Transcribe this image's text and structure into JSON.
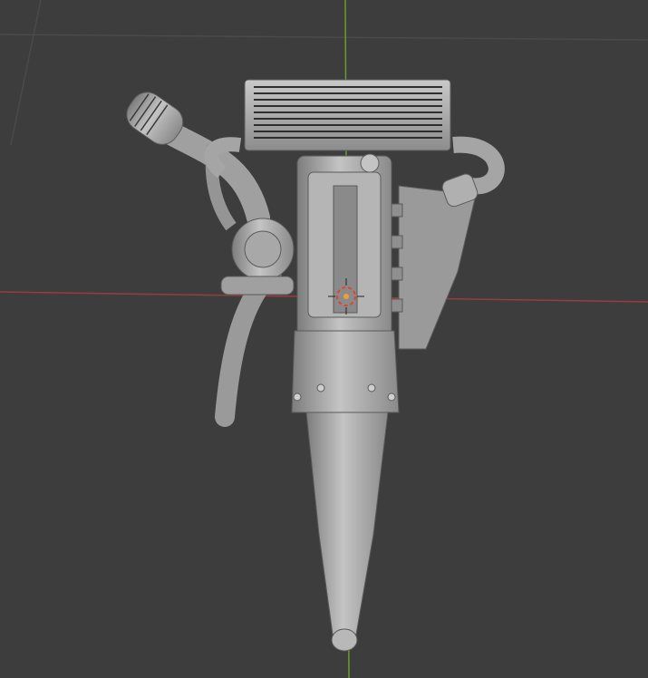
{
  "viewport": {
    "background": "#3d3d3d",
    "grid_color": "#4a4a4a",
    "x_axis_color": "#9a3a44",
    "y_axis_color": "#6f9a2a",
    "model_color": "#a8a8a8",
    "cursor_color": "#e0422f"
  }
}
